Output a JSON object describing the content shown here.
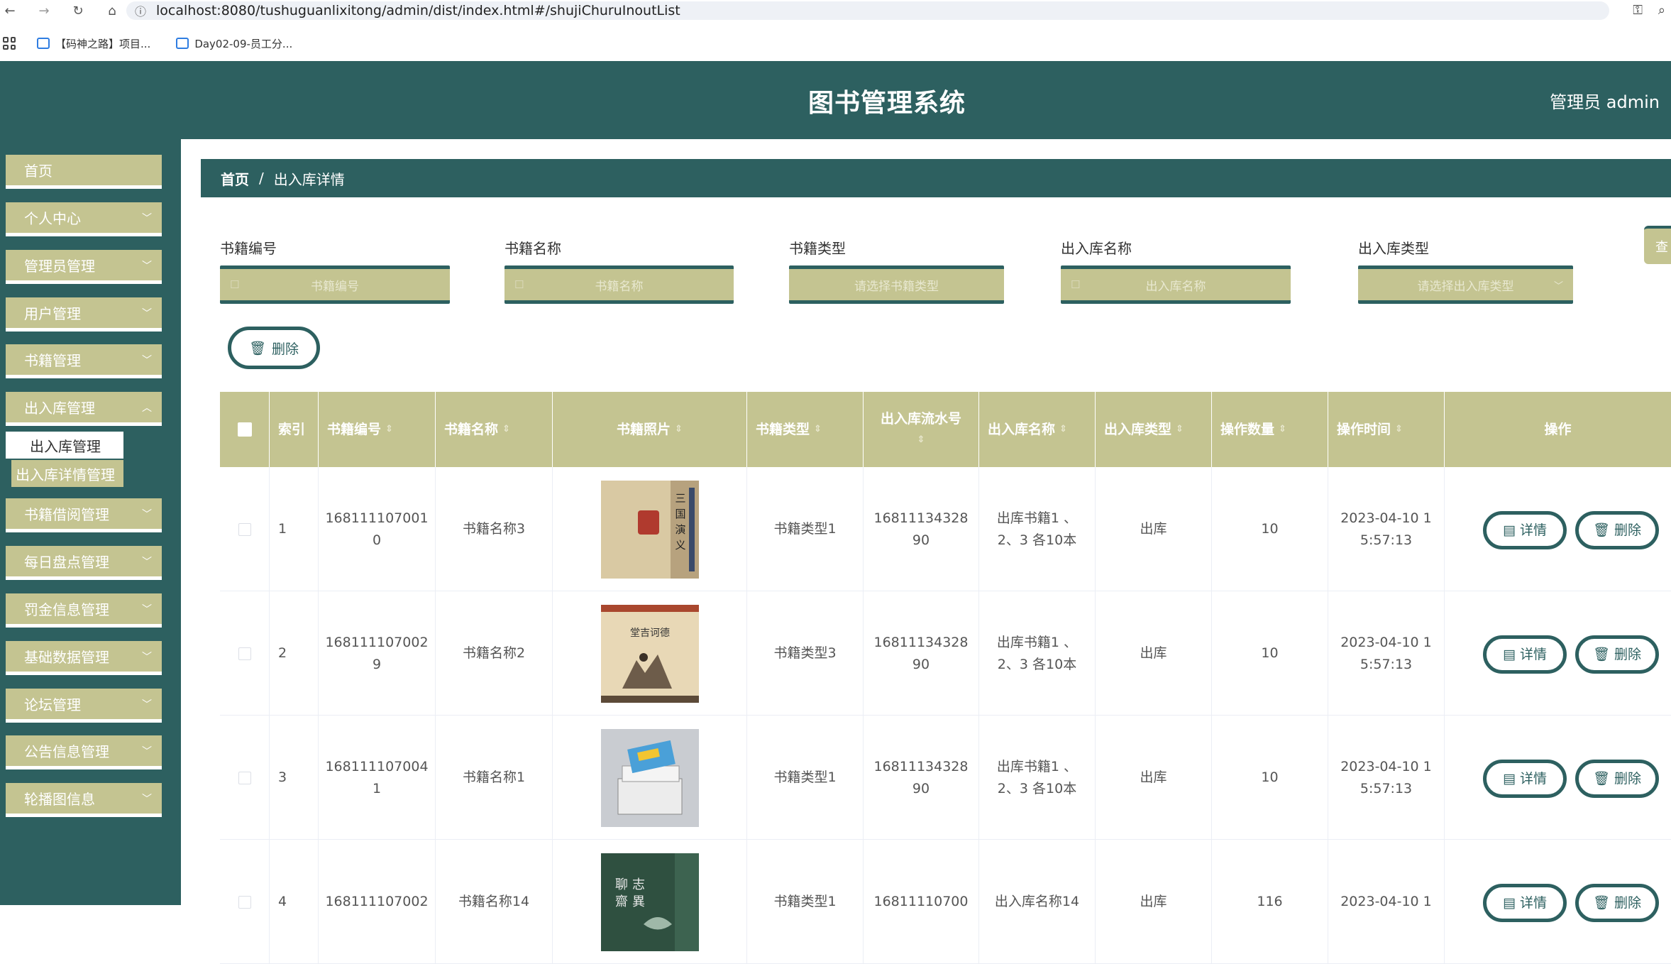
{
  "browser": {
    "url": "localhost:8080/tushuguanlixitong/admin/dist/index.html#/shujiChuruInoutList",
    "bookmarks": [
      "【码神之路】项目...",
      "Day02-09-员工分..."
    ]
  },
  "header": {
    "title": "图书管理系统",
    "user": "管理员 admin"
  },
  "sidebar": {
    "items": [
      {
        "label": "首页"
      },
      {
        "label": "个人中心"
      },
      {
        "label": "管理员管理"
      },
      {
        "label": "用户管理"
      },
      {
        "label": "书籍管理"
      },
      {
        "label": "出入库管理"
      },
      {
        "label": "书籍借阅管理"
      },
      {
        "label": "每日盘点管理"
      },
      {
        "label": "罚金信息管理"
      },
      {
        "label": "基础数据管理"
      },
      {
        "label": "论坛管理"
      },
      {
        "label": "公告信息管理"
      },
      {
        "label": "轮播图信息"
      }
    ],
    "sub_items": [
      "出入库管理",
      "出入库详情管理"
    ]
  },
  "breadcrumb": {
    "home": "首页",
    "separator": "/",
    "current": "出入库详情"
  },
  "search": {
    "fields": [
      {
        "label": "书籍编号",
        "placeholder": "书籍编号"
      },
      {
        "label": "书籍名称",
        "placeholder": "书籍名称"
      },
      {
        "label": "书籍类型",
        "placeholder": "请选择书籍类型"
      },
      {
        "label": "出入库名称",
        "placeholder": "出入库名称"
      },
      {
        "label": "出入库类型",
        "placeholder": "请选择出入库类型"
      }
    ],
    "button_label": "查"
  },
  "actions": {
    "delete_label": "删除"
  },
  "table": {
    "headers": [
      "索引",
      "书籍编号",
      "书籍名称",
      "书籍照片",
      "书籍类型",
      "出入库流水号",
      "出入库名称",
      "出入库类型",
      "操作数量",
      "操作时间",
      "操作"
    ],
    "rows": [
      {
        "index": "1",
        "code_a": "168111107001",
        "code_b": "0",
        "name": "书籍名称3",
        "type": "书籍类型1",
        "serial_a": "16811134328",
        "serial_b": "90",
        "io_name_a": "出库书籍1 、",
        "io_name_b": "2、3 各10本",
        "io_type": "出库",
        "qty": "10",
        "time_a": "2023-04-10 1",
        "time_b": "5:57:13"
      },
      {
        "index": "2",
        "code_a": "168111107002",
        "code_b": "9",
        "name": "书籍名称2",
        "type": "书籍类型3",
        "serial_a": "16811134328",
        "serial_b": "90",
        "io_name_a": "出库书籍1 、",
        "io_name_b": "2、3 各10本",
        "io_type": "出库",
        "qty": "10",
        "time_a": "2023-04-10 1",
        "time_b": "5:57:13"
      },
      {
        "index": "3",
        "code_a": "168111107004",
        "code_b": "1",
        "name": "书籍名称1",
        "type": "书籍类型1",
        "serial_a": "16811134328",
        "serial_b": "90",
        "io_name_a": "出库书籍1 、",
        "io_name_b": "2、3 各10本",
        "io_type": "出库",
        "qty": "10",
        "time_a": "2023-04-10 1",
        "time_b": "5:57:13"
      },
      {
        "index": "4",
        "code_a": "168111107002",
        "code_b": "",
        "name": "书籍名称14",
        "type": "书籍类型1",
        "serial_a": "16811110700",
        "serial_b": "",
        "io_name_a": "出入库名称14",
        "io_name_b": "",
        "io_type": "出库",
        "qty": "116",
        "time_a": "2023-04-10 1",
        "time_b": ""
      }
    ],
    "detail_label": "详情",
    "delete_label": "删除"
  },
  "colors": {
    "primary": "#2d6060",
    "accent": "#c4c491"
  }
}
